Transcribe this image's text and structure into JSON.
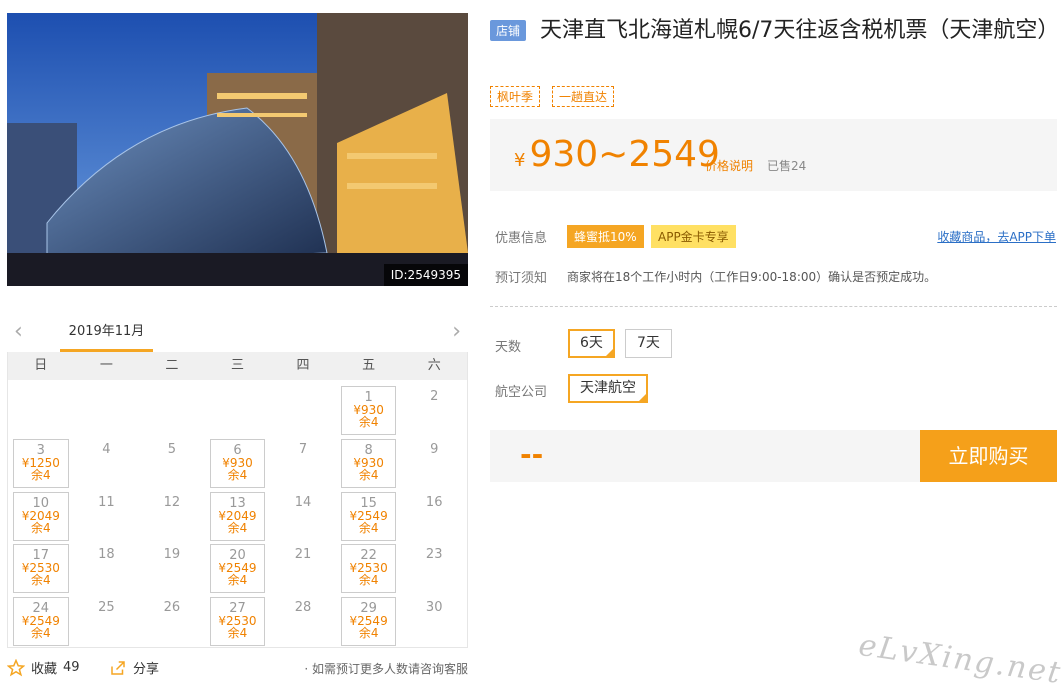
{
  "photo": {
    "id_label": "ID:2549395"
  },
  "calendar": {
    "month": "2019年11月",
    "prev": "‹",
    "next": "›",
    "weekdays": [
      "日",
      "一",
      "二",
      "三",
      "四",
      "五",
      "六"
    ],
    "days": [
      {
        "d": "",
        "p": "",
        "r": ""
      },
      {
        "d": "",
        "p": "",
        "r": ""
      },
      {
        "d": "",
        "p": "",
        "r": ""
      },
      {
        "d": "",
        "p": "",
        "r": ""
      },
      {
        "d": "",
        "p": "",
        "r": ""
      },
      {
        "d": "1",
        "p": "¥930",
        "r": "余4"
      },
      {
        "d": "2",
        "p": "",
        "r": ""
      },
      {
        "d": "3",
        "p": "¥1250",
        "r": "余4"
      },
      {
        "d": "4",
        "p": "",
        "r": ""
      },
      {
        "d": "5",
        "p": "",
        "r": ""
      },
      {
        "d": "6",
        "p": "¥930",
        "r": "余4"
      },
      {
        "d": "7",
        "p": "",
        "r": ""
      },
      {
        "d": "8",
        "p": "¥930",
        "r": "余4"
      },
      {
        "d": "9",
        "p": "",
        "r": ""
      },
      {
        "d": "10",
        "p": "¥2049",
        "r": "余4"
      },
      {
        "d": "11",
        "p": "",
        "r": ""
      },
      {
        "d": "12",
        "p": "",
        "r": ""
      },
      {
        "d": "13",
        "p": "¥2049",
        "r": "余4"
      },
      {
        "d": "14",
        "p": "",
        "r": ""
      },
      {
        "d": "15",
        "p": "¥2549",
        "r": "余4"
      },
      {
        "d": "16",
        "p": "",
        "r": ""
      },
      {
        "d": "17",
        "p": "¥2530",
        "r": "余4"
      },
      {
        "d": "18",
        "p": "",
        "r": ""
      },
      {
        "d": "19",
        "p": "",
        "r": ""
      },
      {
        "d": "20",
        "p": "¥2549",
        "r": "余4"
      },
      {
        "d": "21",
        "p": "",
        "r": ""
      },
      {
        "d": "22",
        "p": "¥2530",
        "r": "余4"
      },
      {
        "d": "23",
        "p": "",
        "r": ""
      },
      {
        "d": "24",
        "p": "¥2549",
        "r": "余4"
      },
      {
        "d": "25",
        "p": "",
        "r": ""
      },
      {
        "d": "26",
        "p": "",
        "r": ""
      },
      {
        "d": "27",
        "p": "¥2530",
        "r": "余4"
      },
      {
        "d": "28",
        "p": "",
        "r": ""
      },
      {
        "d": "29",
        "p": "¥2549",
        "r": "余4"
      },
      {
        "d": "30",
        "p": "",
        "r": ""
      }
    ]
  },
  "bottom": {
    "fav_label": "收藏",
    "fav_count": "49",
    "share_label": "分享",
    "note": "· 如需预订更多人数请咨询客服"
  },
  "product": {
    "badge": "店铺",
    "title": "天津直飞北海道札幌6/7天往返含税机票（天津航空）",
    "tags": [
      "枫叶季",
      "一趟直达"
    ],
    "currency": "¥",
    "price": "930~2549",
    "price_note": "价格说明",
    "sold": "已售24"
  },
  "info": {
    "promo_label": "优惠信息",
    "promo1": "蜂蜜抵10%",
    "promo2": "APP金卡专享",
    "fav_link": "收藏商品，去APP下单",
    "notice_label": "预订须知",
    "notice": "商家将在18个工作小时内（工作日9:00-18:00）确认是否预定成功。"
  },
  "options": {
    "days_label": "天数",
    "days": [
      "6天",
      "7天"
    ],
    "airline_label": "航空公司",
    "airline": "天津航空"
  },
  "buy": {
    "total": "--",
    "button": "立即购买"
  },
  "watermark": "eLvXing.net",
  "colors": {
    "accent": "#f5a623",
    "price": "#f08200",
    "link": "#2b6fc6"
  }
}
